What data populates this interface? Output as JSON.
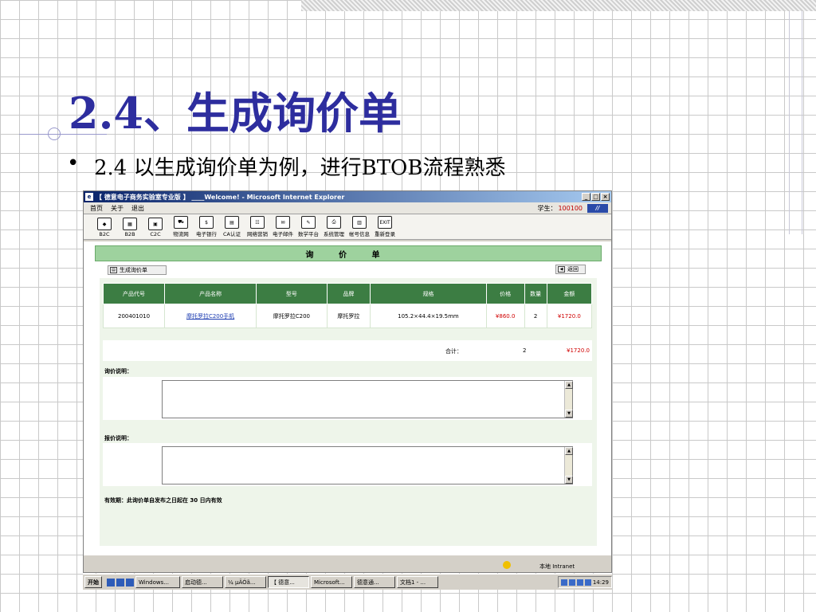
{
  "slide": {
    "title": "2.4、生成询价单",
    "bullet": "•",
    "bullet_text": "2.4 以生成询价单为例，进行BTOB流程熟悉"
  },
  "browser": {
    "title": "【 德意电子商务实验室专业版 】 ____Welcome! - Microsoft Internet Explorer",
    "window_buttons": [
      "_",
      "□",
      "×"
    ],
    "menu": [
      "首页",
      "关于",
      "退出"
    ],
    "student_label": "学生：",
    "student_id": "100100",
    "toolbar": [
      {
        "label": "B2C",
        "icon": "B2C-icon"
      },
      {
        "label": "B2B",
        "icon": "B2B-icon"
      },
      {
        "label": "C2C",
        "icon": "C2C-icon"
      },
      {
        "label": "物流网",
        "icon": "truck-icon"
      },
      {
        "label": "电子银行",
        "icon": "bank-icon"
      },
      {
        "label": "CA认证",
        "icon": "certificate-icon"
      },
      {
        "label": "网络营销",
        "icon": "marketing-icon"
      },
      {
        "label": "电子邮件",
        "icon": "mail-icon"
      },
      {
        "label": "数学平台",
        "icon": "tools-icon"
      },
      {
        "label": "系统管理",
        "icon": "printer-icon"
      },
      {
        "label": "帐号信息",
        "icon": "account-icon"
      },
      {
        "label": "重新登录",
        "icon": "exit-icon"
      }
    ],
    "exit_text": "EXIT",
    "page_header": "询 价 单",
    "gen_button": "生成询价单",
    "back_button": "返回",
    "table": {
      "headers": [
        "产品代号",
        "产品名称",
        "型号",
        "品牌",
        "规格",
        "价格",
        "数量",
        "金额"
      ],
      "row": [
        "200401010",
        "摩托罗拉C200手机",
        "摩托罗拉C200",
        "摩托罗拉",
        "105.2×44.4×19.5mm",
        "¥860.0",
        "2",
        "¥1720.0"
      ]
    },
    "total": {
      "label": "合计：",
      "quantity": "2",
      "amount": "¥1720.0"
    },
    "inquiry_label": "询价说明：",
    "quote_label": "报价说明：",
    "validity": "有效期：此询价单自发布之日起在  30  日内有效",
    "status_zone": "本地 Intranet"
  },
  "taskbar": {
    "start": "开始",
    "tasks": [
      "Windows...",
      "启动德...",
      "¼ µÄÓã...",
      "【 德意...",
      "Microsoft...",
      "德意通...",
      "文档1 - ..."
    ],
    "clock": "14:29"
  },
  "colors": {
    "title": "#2d2d9e",
    "table_header": "#3c7d43",
    "header_band": "#9ed29e",
    "price": "#d00000"
  }
}
